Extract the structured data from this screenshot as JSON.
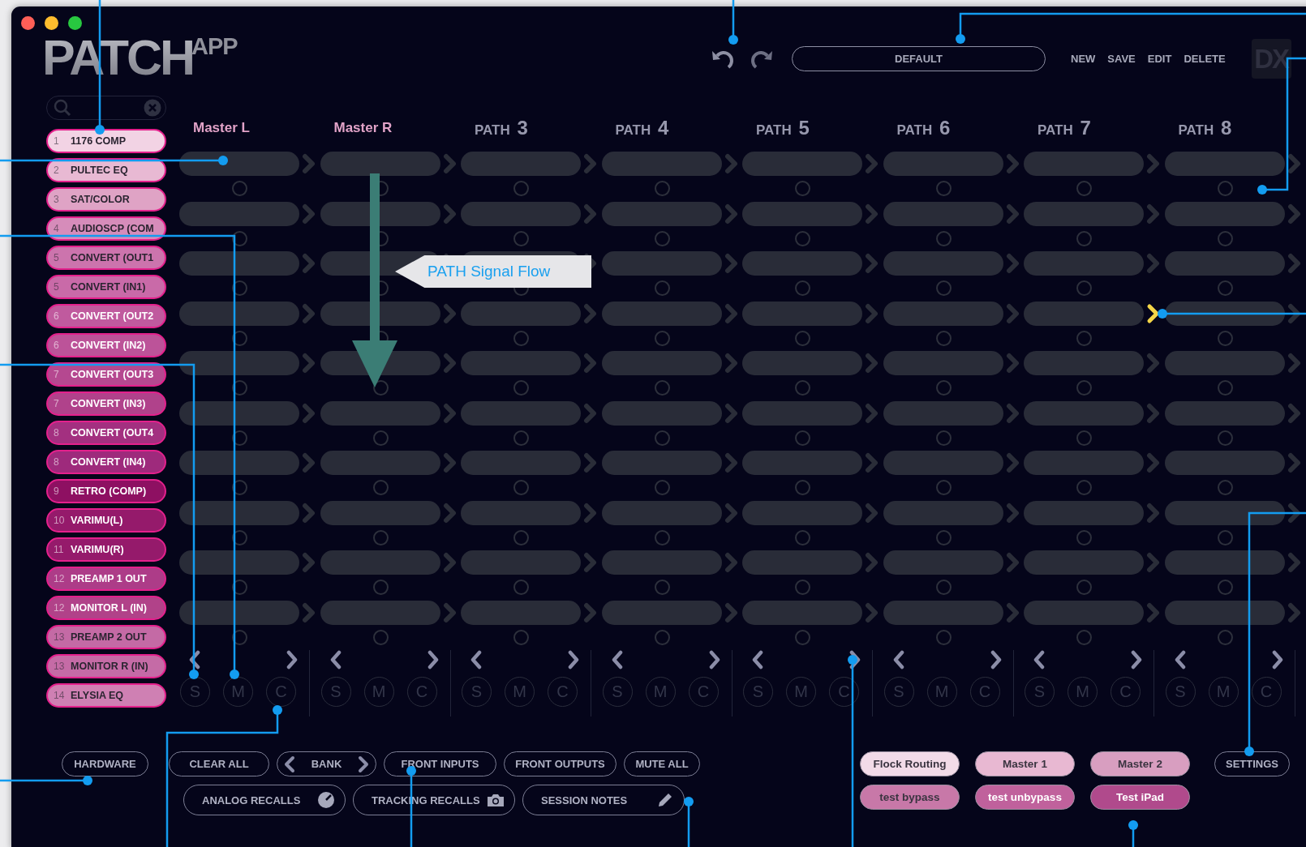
{
  "logo": {
    "main": "PATCH",
    "suffix": "APP"
  },
  "toolbar": {
    "preset": "DEFAULT",
    "actions": [
      "NEW",
      "SAVE",
      "EDIT",
      "DELETE"
    ],
    "badge": "DX"
  },
  "inserts": [
    {
      "number": "1",
      "label": "1176 COMP",
      "color": "#f2d3e4"
    },
    {
      "number": "2",
      "label": "PULTEC EQ",
      "color": "#e8b9d3"
    },
    {
      "number": "3",
      "label": "SAT/COLOR",
      "color": "#dfa3c5"
    },
    {
      "number": "4",
      "label": "AUDIOSCP (COM",
      "color": "#d68cba"
    },
    {
      "number": "5",
      "label": "CONVERT (OUT1",
      "color": "#cc74ad"
    },
    {
      "number": "5",
      "label": "CONVERT (IN1)",
      "color": "#c96aa8"
    },
    {
      "number": "6",
      "label": "CONVERT (OUT2",
      "color": "#c05a9e"
    },
    {
      "number": "6",
      "label": "CONVERT (IN2)",
      "color": "#bc5399"
    },
    {
      "number": "7",
      "label": "CONVERT (OUT3",
      "color": "#b54890"
    },
    {
      "number": "7",
      "label": "CONVERT (IN3)",
      "color": "#b0428b"
    },
    {
      "number": "8",
      "label": "CONVERT (OUT4",
      "color": "#a33080"
    },
    {
      "number": "8",
      "label": "CONVERT (IN4)",
      "color": "#9e2a7c"
    },
    {
      "number": "9",
      "label": "RETRO (COMP)",
      "color": "#8e1062"
    },
    {
      "number": "10",
      "label": "VARIMU(L)",
      "color": "#951a6b"
    },
    {
      "number": "11",
      "label": "VARIMU(R)",
      "color": "#951a6b"
    },
    {
      "number": "12",
      "label": "PREAMP 1 OUT",
      "color": "#ad3c88"
    },
    {
      "number": "12",
      "label": "MONITOR L (IN)",
      "color": "#b14289"
    },
    {
      "number": "13",
      "label": "PREAMP 2 OUT",
      "color": "#c46aa5"
    },
    {
      "number": "13",
      "label": "MONITOR R (IN)",
      "color": "#c56ba6"
    },
    {
      "number": "14",
      "label": "ELYSIA EQ",
      "color": "#cf80b3"
    }
  ],
  "paths": [
    {
      "kind": "master",
      "name": "Master L",
      "links": [
        false,
        false,
        false,
        false,
        false,
        false,
        false,
        false,
        false,
        false
      ],
      "controls": [
        "S",
        "M",
        "C"
      ]
    },
    {
      "kind": "master",
      "name": "Master R",
      "links": [
        false,
        false,
        false,
        false,
        false,
        false,
        false,
        false,
        false,
        false
      ],
      "controls": [
        "S",
        "M",
        "C"
      ]
    },
    {
      "kind": "numbered",
      "name": "PATH",
      "number": "3",
      "links": [
        false,
        false,
        false,
        false,
        false,
        false,
        false,
        false,
        false,
        false
      ],
      "controls": [
        "S",
        "M",
        "C"
      ]
    },
    {
      "kind": "numbered",
      "name": "PATH",
      "number": "4",
      "links": [
        false,
        false,
        false,
        false,
        false,
        false,
        false,
        false,
        false,
        false
      ],
      "controls": [
        "S",
        "M",
        "C"
      ]
    },
    {
      "kind": "numbered",
      "name": "PATH",
      "number": "5",
      "links": [
        false,
        false,
        false,
        false,
        false,
        false,
        false,
        false,
        false,
        false
      ],
      "controls": [
        "S",
        "M",
        "C"
      ]
    },
    {
      "kind": "numbered",
      "name": "PATH",
      "number": "6",
      "links": [
        false,
        false,
        false,
        false,
        false,
        false,
        false,
        false,
        false,
        false
      ],
      "controls": [
        "S",
        "M",
        "C"
      ]
    },
    {
      "kind": "numbered",
      "name": "PATH",
      "number": "7",
      "links": [
        false,
        false,
        false,
        true,
        false,
        false,
        false,
        false,
        false,
        false
      ],
      "controls": [
        "S",
        "M",
        "C"
      ]
    },
    {
      "kind": "numbered",
      "name": "PATH",
      "number": "8",
      "links": [
        false,
        false,
        false,
        false,
        false,
        false,
        false,
        false,
        false,
        false
      ],
      "controls": [
        "S",
        "M",
        "C"
      ]
    }
  ],
  "annotation": {
    "label": "PATH Signal Flow"
  },
  "footer": {
    "hardware": "HARDWARE",
    "actions": [
      {
        "kind": "plain",
        "label": "CLEAR ALL"
      },
      {
        "kind": "bank",
        "label": "BANK"
      },
      {
        "kind": "plain",
        "label": "FRONT INPUTS"
      },
      {
        "kind": "plain",
        "label": "FRONT OUTPUTS"
      },
      {
        "kind": "plain",
        "label": "MUTE ALL"
      }
    ],
    "recalls": [
      {
        "kind": "dial",
        "label": "ANALOG RECALLS"
      },
      {
        "kind": "camera",
        "label": "TRACKING RECALLS"
      },
      {
        "kind": "pencil",
        "label": "SESSION NOTES"
      }
    ],
    "scenes": [
      {
        "label": "Flock Routing",
        "color": "#f2dbe8"
      },
      {
        "label": "Master 1",
        "color": "#e8b8d2"
      },
      {
        "label": "Master 2",
        "color": "#d89ec0"
      },
      {
        "label": "test bypass",
        "color": "#c878a8"
      },
      {
        "label": "test unbypass",
        "color": "#c0619c"
      },
      {
        "label": "Test iPad",
        "color": "#b04a8c"
      }
    ],
    "settings": "SETTINGS"
  }
}
